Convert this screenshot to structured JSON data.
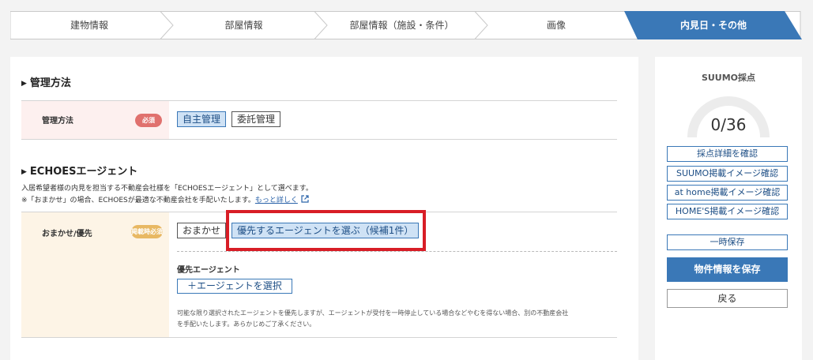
{
  "steps": [
    {
      "label": "建物情報",
      "active": false
    },
    {
      "label": "部屋情報",
      "active": false
    },
    {
      "label": "部屋情報（施設・条件）",
      "active": false
    },
    {
      "label": "画像",
      "active": false
    },
    {
      "label": "内見日・その他",
      "active": true
    }
  ],
  "management": {
    "section_title": "管理方法",
    "row_label": "管理方法",
    "badge": "必須",
    "options": [
      "自主管理",
      "委託管理"
    ],
    "selected": "自主管理"
  },
  "agent": {
    "section_title": "ECHOESエージェント",
    "desc_line1": "入居希望者様の内見を担当する不動産会社様を「ECHOESエージェント」として選べます。",
    "desc_line2": "※「おまかせ」の場合、ECHOESが最適な不動産会社を手配いたします。",
    "more_link": "もっと詳しく",
    "row_label": "おまかせ/優先",
    "badge": "掲載時必須",
    "options": [
      "おまかせ",
      "優先するエージェントを選ぶ（候補1件）"
    ],
    "selected": "優先するエージェントを選ぶ（候補1件）",
    "priority_label": "優先エージェント",
    "select_button": "＋エージェントを選択",
    "note_line1": "可能な限り選択されたエージェントを優先しますが、エージェントが受付を一時停止している場合などやむを得ない場合、別の不動産会社",
    "note_line2": "を手配いたします。あらかじめご了承ください。"
  },
  "sidebar": {
    "title": "SUUMO採点",
    "score": "0/36",
    "score_value": 0,
    "score_max": 36,
    "buttons": [
      "採点詳細を確認",
      "SUUMO掲載イメージ確認",
      "at home掲載イメージ確認",
      "HOME'S掲載イメージ確認"
    ],
    "temp_save": "一時保存",
    "save": "物件情報を保存",
    "back": "戻る"
  },
  "colors": {
    "accent": "#3a78b7",
    "required_badge": "#e0716e",
    "publish_badge": "#e8b863",
    "highlight": "#d81d26",
    "required_row_bg": "#fdf0ef",
    "publish_row_bg": "#fdf4e6"
  }
}
